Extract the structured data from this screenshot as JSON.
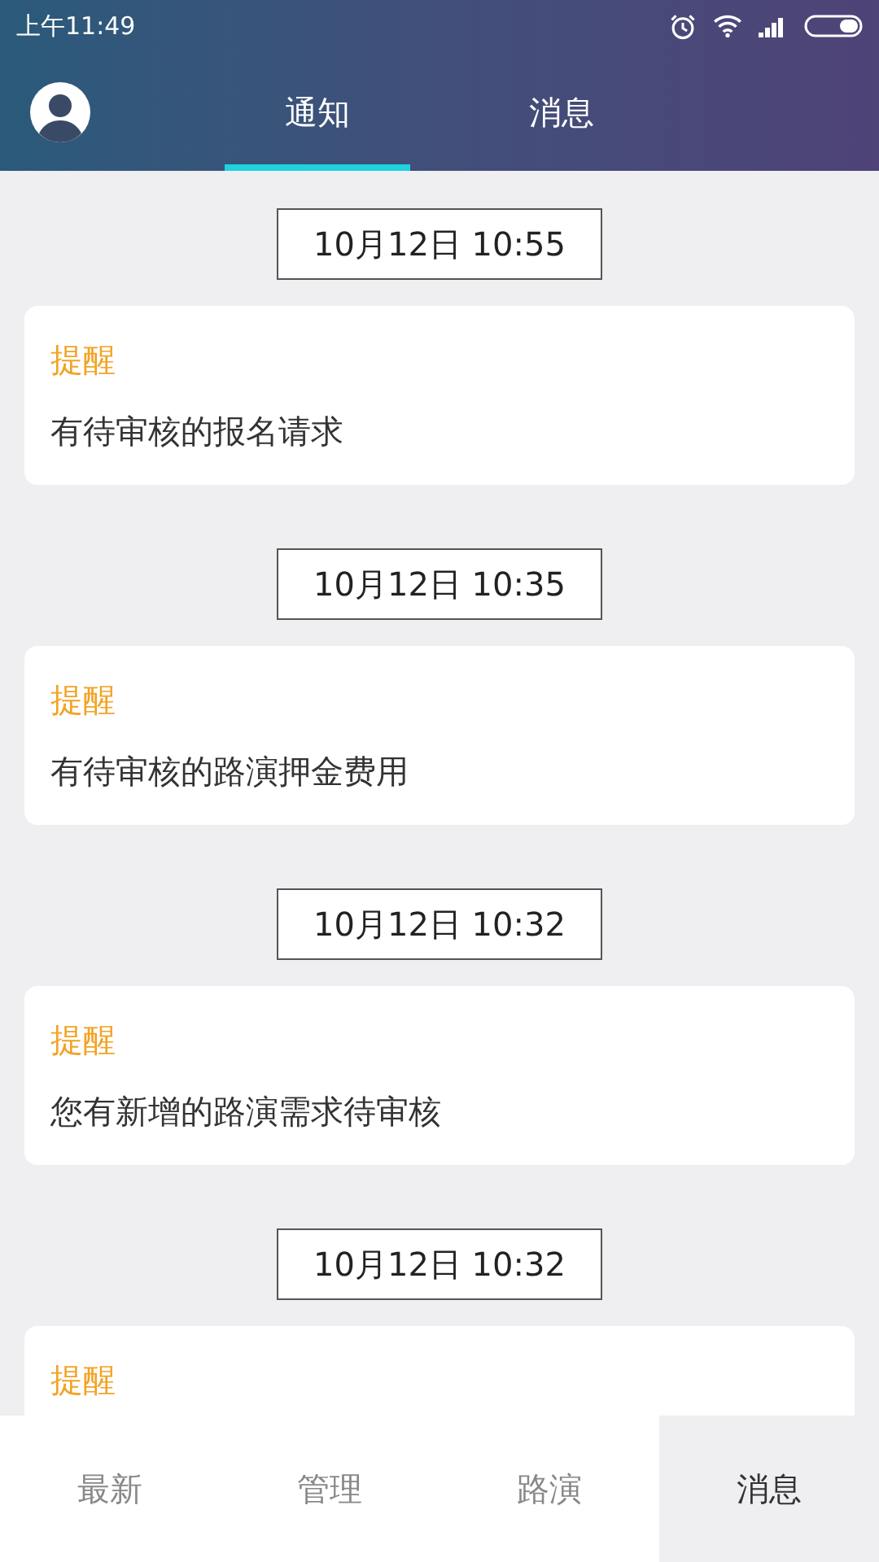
{
  "status_bar": {
    "time": "上午11:49"
  },
  "tabs": [
    {
      "label": "通知",
      "selected": true
    },
    {
      "label": "消息",
      "selected": false
    }
  ],
  "notifications": [
    {
      "time": "10月12日 10:55",
      "title": "提醒",
      "message": "有待审核的报名请求"
    },
    {
      "time": "10月12日 10:35",
      "title": "提醒",
      "message": "有待审核的路演押金费用"
    },
    {
      "time": "10月12日 10:32",
      "title": "提醒",
      "message": "您有新增的路演需求待审核"
    },
    {
      "time": "10月12日 10:32",
      "title": "提醒"
    }
  ],
  "bottom_nav": [
    {
      "label": "最新",
      "selected": false
    },
    {
      "label": "管理",
      "selected": false
    },
    {
      "label": "路演",
      "selected": false
    },
    {
      "label": "消息",
      "selected": true
    }
  ]
}
